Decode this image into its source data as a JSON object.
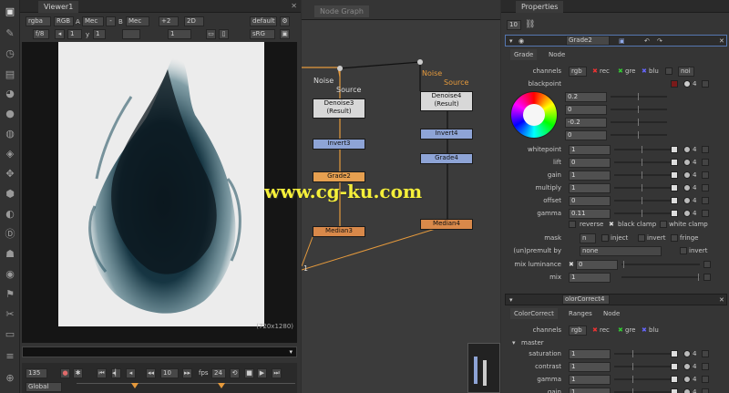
{
  "viewer": {
    "tab": "Viewer1",
    "channels": "rgba",
    "colorspace": "RGB",
    "a_label": "A",
    "a_input": "Mec",
    "b_label": "B",
    "b_input": "Mec",
    "gain": "+2",
    "mode": "2D",
    "lut": "default",
    "fstop": "f/8",
    "frame_num": "1",
    "y_label": "y",
    "y_val": "1",
    "zoom": "1",
    "srgb": "sRG",
    "resolution": "(720x1280)",
    "current_frame": "135",
    "step": "10",
    "fps_label": "fps",
    "fps": "24",
    "scope": "Global"
  },
  "nodegraph": {
    "tab": "Node Graph",
    "labels": {
      "noise1": "Noise",
      "source1": "Source",
      "noise2": "Noise",
      "source2": "Source"
    },
    "nodes": {
      "denoise3": "Denoise3\n(Result)",
      "invert3": "Invert3",
      "grade2": "Grade2",
      "median3": "Median3",
      "denoise4": "Denoise4\n(Result)",
      "invert4": "Invert4",
      "grade4": "Grade4",
      "median4": "Median4"
    },
    "marker": "1"
  },
  "watermark": "www.cg-ku.com",
  "properties": {
    "tab": "Properties",
    "max_panels": "10",
    "grade_panel": {
      "title": "Grade2",
      "tabs": [
        "Grade",
        "Node"
      ],
      "channels_label": "channels",
      "channels": "rgb",
      "ch_r": "rec",
      "ch_g": "gre",
      "ch_b": "blu",
      "ch_none": "noi",
      "blackpoint_label": "blackpoint",
      "blackpoint": [
        "0.2",
        "0",
        "-0.2",
        "0"
      ],
      "rows": [
        {
          "label": "whitepoint",
          "value": "1"
        },
        {
          "label": "lift",
          "value": "0"
        },
        {
          "label": "gain",
          "value": "1"
        },
        {
          "label": "multiply",
          "value": "1"
        },
        {
          "label": "offset",
          "value": "0"
        },
        {
          "label": "gamma",
          "value": "0.11"
        }
      ],
      "reverse": "reverse",
      "black_clamp": "black clamp",
      "white_clamp": "white clamp",
      "mask_label": "mask",
      "mask": "n",
      "inject": "inject",
      "invert": "invert",
      "fringe": "fringe",
      "unpremult_label": "(un)premult by",
      "unpremult": "none",
      "invert2": "invert",
      "mixlum_label": "mix luminance",
      "mixlum": "0",
      "mix_label": "mix",
      "mix": "1",
      "four": "4"
    },
    "cc_panel": {
      "title": "olorCorrect4",
      "tabs": [
        "ColorCorrect",
        "Ranges",
        "Node"
      ],
      "channels_label": "channels",
      "channels": "rgb",
      "ch_r": "rec",
      "ch_g": "gre",
      "ch_b": "blu",
      "master": "master",
      "rows": [
        {
          "label": "saturation",
          "value": "1"
        },
        {
          "label": "contrast",
          "value": "1"
        },
        {
          "label": "gamma",
          "value": "1"
        },
        {
          "label": "gain",
          "value": "1"
        }
      ]
    }
  },
  "colors": {
    "accent": "#e69a3c",
    "wm": "#f5ef3a"
  }
}
